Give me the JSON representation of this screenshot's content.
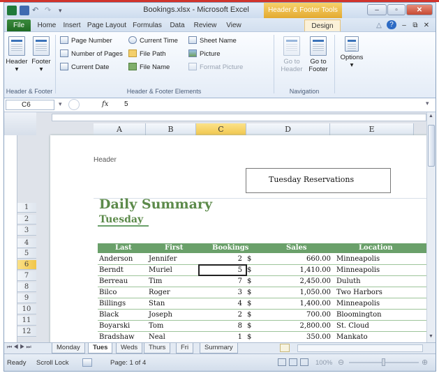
{
  "window": {
    "title": "Bookings.xlsx - Microsoft Excel",
    "contextual_tab_group": "Header & Footer Tools",
    "controls": {
      "minimize": "–",
      "maximize": "▫",
      "close": "✕"
    }
  },
  "ribbon_tabs": [
    "File",
    "Home",
    "Insert",
    "Page Layout",
    "Formulas",
    "Data",
    "Review",
    "View",
    "Design"
  ],
  "ribbon": {
    "group_header_footer": {
      "label": "Header & Footer",
      "header": "Header",
      "footer": "Footer"
    },
    "group_elements": {
      "label": "Header & Footer Elements",
      "page_number": "Page Number",
      "number_of_pages": "Number of Pages",
      "current_date": "Current Date",
      "current_time": "Current Time",
      "file_path": "File Path",
      "file_name": "File Name",
      "sheet_name": "Sheet Name",
      "picture": "Picture",
      "format_picture": "Format Picture"
    },
    "group_navigation": {
      "label": "Navigation",
      "goto_header": "Go to Header",
      "goto_footer": "Go to Footer"
    },
    "group_options": {
      "options": "Options"
    }
  },
  "formula_bar": {
    "cell_ref": "C6",
    "fx": "fx",
    "value": "5"
  },
  "columns": [
    "A",
    "B",
    "C",
    "D",
    "E"
  ],
  "rows": [
    "1",
    "2",
    "3",
    "4",
    "5",
    "6",
    "7",
    "8",
    "9",
    "10",
    "11",
    "12"
  ],
  "page": {
    "header_label": "Header",
    "header_text": "Tuesday Reservations",
    "title": "Daily Summary",
    "subtitle": "Tuesday",
    "table_headers": [
      "Last",
      "First",
      "Bookings",
      "Sales",
      "Location"
    ],
    "table_rows": [
      {
        "last": "Anderson",
        "first": "Jennifer",
        "bookings": "2",
        "cur": "$",
        "sales": "660.00",
        "location": "Minneapolis"
      },
      {
        "last": "Berndt",
        "first": "Muriel",
        "bookings": "5",
        "cur": "$",
        "sales": "1,410.00",
        "location": "Minneapolis"
      },
      {
        "last": "Berreau",
        "first": "Tim",
        "bookings": "7",
        "cur": "$",
        "sales": "2,450.00",
        "location": "Duluth"
      },
      {
        "last": "Bilco",
        "first": "Roger",
        "bookings": "3",
        "cur": "$",
        "sales": "1,050.00",
        "location": "Two Harbors"
      },
      {
        "last": "Billings",
        "first": "Stan",
        "bookings": "4",
        "cur": "$",
        "sales": "1,400.00",
        "location": "Minneapolis"
      },
      {
        "last": "Black",
        "first": "Joseph",
        "bookings": "2",
        "cur": "$",
        "sales": "700.00",
        "location": "Bloomington"
      },
      {
        "last": "Boyarski",
        "first": "Tom",
        "bookings": "8",
        "cur": "$",
        "sales": "2,800.00",
        "location": "St. Cloud"
      },
      {
        "last": "Bradshaw",
        "first": "Neal",
        "bookings": "1",
        "cur": "$",
        "sales": "350.00",
        "location": "Mankato"
      }
    ]
  },
  "sheet_tabs": [
    "Monday",
    "Tues",
    "Weds",
    "Thurs",
    "Fri",
    "Summary"
  ],
  "active_sheet": "Tues",
  "status": {
    "ready": "Ready",
    "scroll_lock": "Scroll Lock",
    "page": "Page: 1 of 4",
    "zoom": "100%"
  },
  "colors": {
    "accent_green": "#6aa06a",
    "title_green": "#5c8a4a",
    "file_tab": "#2b7a2f",
    "selection": "#f5c842"
  }
}
